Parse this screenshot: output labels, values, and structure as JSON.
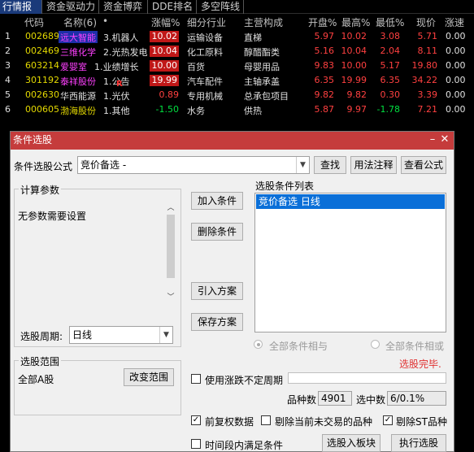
{
  "tabs": [
    {
      "label": "行情报价",
      "active": true
    },
    {
      "label": "资金驱动力",
      "active": false
    },
    {
      "label": "资金博弈",
      "active": false
    },
    {
      "label": "DDE排名",
      "active": false
    },
    {
      "label": "多空阵线",
      "active": false
    }
  ],
  "columns": {
    "code": "代码",
    "name": "名称(6)",
    "dot": "•",
    "change_pct": "涨幅%",
    "industry": "细分行业",
    "main_business": "主营构成",
    "open_pct": "开盘%",
    "high_pct": "最高%",
    "low_pct": "最低%",
    "price": "现价",
    "speed": "涨速"
  },
  "rows": [
    {
      "idx": "1",
      "code": "002689",
      "name": "远大智能",
      "concept": "3.机器人",
      "change": "10.02",
      "industry": "运输设备",
      "business": "直梯",
      "open": "5.97",
      "high": "10.02",
      "low": "3.08",
      "price": "5.71",
      "speed": "0.00"
    },
    {
      "idx": "2",
      "code": "002469",
      "name": "三维化学",
      "concept": "2.光热发电",
      "change": "10.04",
      "industry": "化工原料",
      "business": "醇醋酯类",
      "open": "5.16",
      "high": "10.04",
      "low": "2.04",
      "price": "8.11",
      "speed": "0.00"
    },
    {
      "idx": "3",
      "code": "603214",
      "name": "爱婴室",
      "concept": "1.业绩增长",
      "change": "10.00",
      "industry": "百货",
      "business": "母婴用品",
      "open": "9.83",
      "high": "10.00",
      "low": "5.17",
      "price": "19.80",
      "speed": "0.00"
    },
    {
      "idx": "4",
      "code": "301192",
      "name": "泰祥股份",
      "concept": "1.公告",
      "change": "19.99",
      "industry": "汽车配件",
      "business": "主轴承盖",
      "open": "6.35",
      "high": "19.99",
      "low": "6.35",
      "price": "34.22",
      "speed": "0.00"
    },
    {
      "idx": "5",
      "code": "002630",
      "name": "华西能源",
      "concept": "1.光伏",
      "change": "0.89",
      "industry": "专用机械",
      "business": "总承包项目",
      "open": "9.82",
      "high": "9.82",
      "low": "0.30",
      "price": "3.39",
      "speed": "0.00"
    },
    {
      "idx": "6",
      "code": "000605",
      "name": "渤海股份",
      "concept": "1.其他",
      "change": "-1.50",
      "industry": "水务",
      "business": "供热",
      "open": "5.87",
      "high": "9.97",
      "low": "-1.78",
      "price": "7.21",
      "speed": "0.00"
    }
  ],
  "row4_marker": "R",
  "dialog": {
    "title": "条件选股",
    "formula_label": "条件选股公式",
    "formula_value": "竞价备选    -",
    "btn_find": "查找",
    "btn_usage": "用法注释",
    "btn_view": "查看公式",
    "params_group": "计算参数",
    "params_text": "无参数需要设置",
    "period_label": "选股周期:",
    "period_value": "日线",
    "btn_add": "加入条件",
    "btn_delete": "删除条件",
    "btn_import": "引入方案",
    "btn_save": "保存方案",
    "cond_list_label": "选股条件列表",
    "cond_items": [
      "竞价备选  日线"
    ],
    "radio_and": "全部条件相与",
    "radio_or": "全部条件相或",
    "status": "选股完毕.",
    "range_group": "选股范围",
    "range_value": "全部A股",
    "btn_change_range": "改变范围",
    "use_uncertain": "使用涨跌不定周期",
    "count_label": "品种数",
    "count_value": "4901",
    "selected_label": "选中数",
    "selected_value": "6/0.1%",
    "chk_restore": "前复权数据",
    "chk_exclude_untraded": "剔除当前未交易的品种",
    "chk_exclude_st": "剔除ST品种",
    "chk_time_period": "时间段内满足条件",
    "btn_to_block": "选股入板块",
    "btn_execute": "执行选股"
  },
  "colors": {
    "up": "#ff4040",
    "down": "#00e040",
    "code": "#e4d900",
    "title_bar": "#c53c3c"
  }
}
